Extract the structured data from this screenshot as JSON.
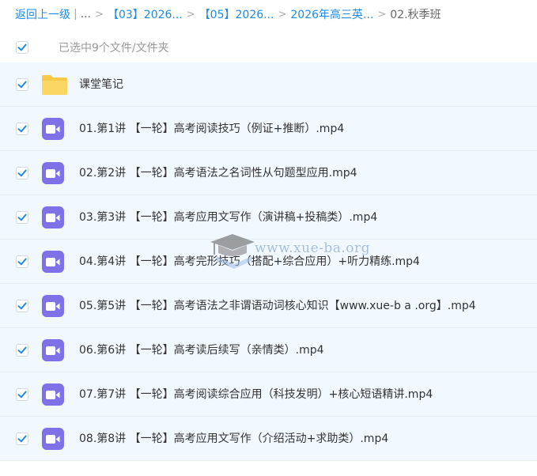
{
  "breadcrumb": {
    "back": "返回上一级",
    "ellipsis": "...",
    "items": [
      "【03】2026...",
      "【05】2026...",
      "2026年高三英..."
    ],
    "current": "02.秋季班"
  },
  "selection": {
    "text": "已选中9个文件/文件夹"
  },
  "files": [
    {
      "name": "课堂笔记",
      "type": "folder"
    },
    {
      "name": "01.第1讲 【一轮】高考阅读技巧（例证+推断）.mp4",
      "type": "video"
    },
    {
      "name": "02.第2讲 【一轮】高考语法之名词性从句题型应用.mp4",
      "type": "video"
    },
    {
      "name": "03.第3讲 【一轮】高考应用文写作（演讲稿+投稿类）.mp4",
      "type": "video"
    },
    {
      "name": "04.第4讲 【一轮】高考完形技巧（搭配+综合应用）+听力精练.mp4",
      "type": "video"
    },
    {
      "name": "05.第5讲 【一轮】高考语法之非谓语动词核心知识【www.xue-b a .org】.mp4",
      "type": "video"
    },
    {
      "name": "06.第6讲 【一轮】高考读后续写（亲情类）.mp4",
      "type": "video"
    },
    {
      "name": "07.第7讲 【一轮】高考阅读综合应用（科技发明）+核心短语精讲.mp4",
      "type": "video"
    },
    {
      "name": "08.第8讲 【一轮】高考应用文写作（介绍活动+求助类）.mp4",
      "type": "video"
    }
  ],
  "watermark": {
    "text": "www.xue-ba.org"
  },
  "colors": {
    "link": "#1e8be6",
    "row_bg": "#f2f8ff",
    "check": "#1e8be6",
    "video_icon": "#7f72e8",
    "folder": "#f9c84a"
  }
}
